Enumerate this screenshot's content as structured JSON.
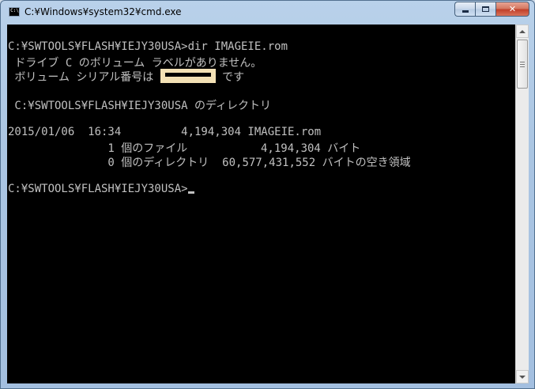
{
  "window": {
    "title": "C:¥Windows¥system32¥cmd.exe",
    "icon": "cmd-icon",
    "controls": {
      "minimize": "minimize-icon",
      "maximize": "maximize-icon",
      "close": "✕"
    }
  },
  "console": {
    "background": "#000000",
    "foreground": "#c0c0c0",
    "lines": [
      "C:¥SWTOOLS¥FLASH¥IEJY30USA>dir IMAGEIE.rom",
      " ドライブ C のボリューム ラベルがありません。",
      " ボリューム シリアル番号は ",
      " です",
      "",
      " C:¥SWTOOLS¥FLASH¥IEJY30USA のディレクトリ",
      "",
      "2015/01/06  16:34         4,194,304 IMAGEIE.rom",
      "               1 個のファイル           4,194,304 バイト",
      "               0 個のディレクトリ  60,577,431,552 バイトの空き領域",
      "",
      "C:¥SWTOOLS¥FLASH¥IEJY30USA>"
    ],
    "serial_masked_color": "#f3e1b5"
  },
  "scrollbar": {
    "up": "up-arrow-icon",
    "down": "down-arrow-icon"
  }
}
